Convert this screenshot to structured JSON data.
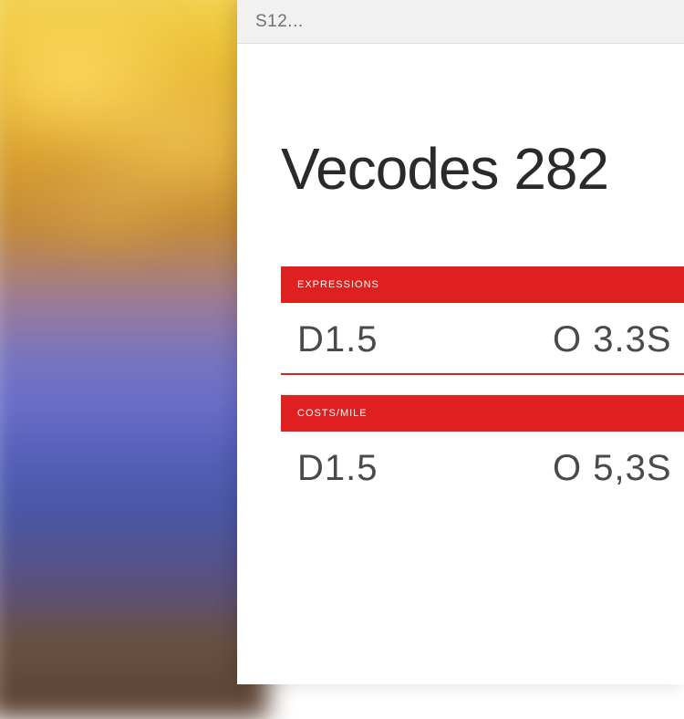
{
  "titlebar": {
    "text": "S12..."
  },
  "heading": "Vecodes 282",
  "sections": [
    {
      "header_label": "EXPRESSIONS",
      "row": {
        "left": "D1.5",
        "right": "O 3.3S"
      }
    },
    {
      "header_label": "COSTS/MILE",
      "row": {
        "left": "D1.5",
        "right": "O 5,3S"
      }
    }
  ],
  "colors": {
    "accent": "#e02020",
    "text_dark": "#2a2a2a",
    "text_muted": "#4a4a4a",
    "titlebar_bg": "#f1f1f1"
  }
}
